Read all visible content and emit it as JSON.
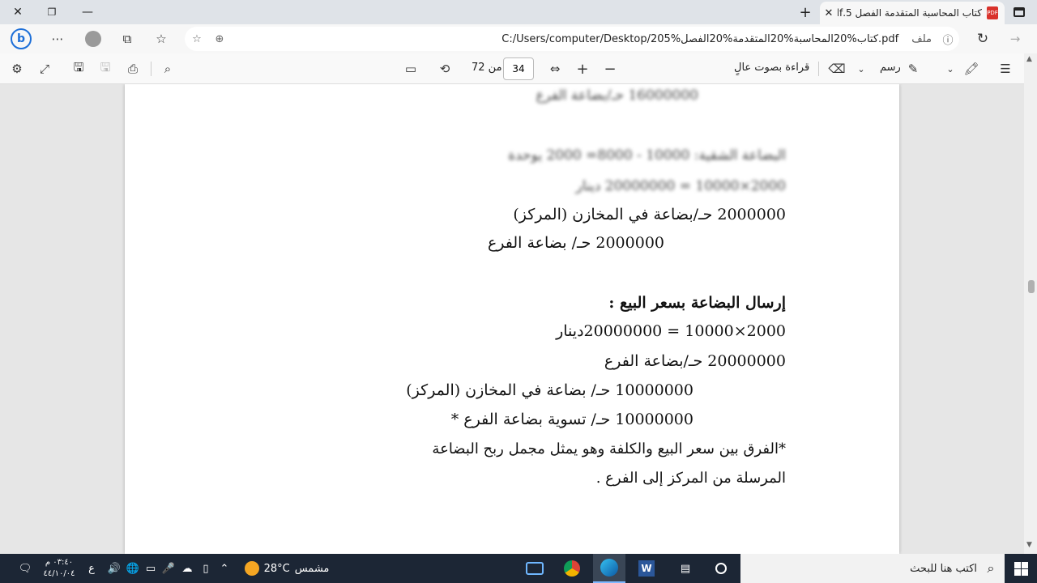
{
  "browser": {
    "tab_title": "كتاب المحاسبة المتقدمة الفصل 5.pdf",
    "url_label": "ملف",
    "url": "C:/Users/computer/Desktop/كتاب%20المحاسبة%20المتقدمة%20الفصل%205.pdf",
    "icons": [
      "close-icon",
      "restore-icon",
      "minimize-icon",
      "new-tab-icon",
      "bing-icon",
      "more-icon",
      "profile-icon",
      "collections-icon",
      "favorites-icon",
      "add-favorite-icon",
      "zoom-icon",
      "info-icon",
      "refresh-icon",
      "forward-icon",
      "tab-actions-icon"
    ]
  },
  "pdf_toolbar": {
    "page_current": "34",
    "page_total_label": "من 72",
    "read_aloud_label": "قراءة بصوت عالٍ",
    "draw_label": "رسم"
  },
  "document": {
    "blurred_lines": [
      "16000000 حـ/بضاعة الفرع",
      "البضاعة الشقية: 10000 - 8000= 2000 يوحدة",
      "2000×10000 = 20000000 دينار"
    ],
    "lines": [
      "2000000  حـ/بضاعة في المخازن (المركز)",
      "2000000 حـ/ بضاعة الفرع",
      "إرسال البضاعة بسعر البيع :",
      "2000×10000 = 20000000دينار",
      "20000000 حـ/بضاعة الفرع",
      "10000000 حـ/ بضاعة في المخازن (المركز)",
      "10000000 حـ/ تسوية بضاعة الفرع *",
      "*الفرق بين سعر البيع والكلفة وهو يمثل مجمل ربح البضاعة",
      "المرسلة من المركز إلى الفرع ."
    ]
  },
  "taskbar": {
    "search_placeholder": "اكتب هنا للبحث",
    "weather_temp": "28°C",
    "weather_label": "مشمس",
    "keyboard_lang": "ع",
    "time": "٠٣:٤٠ م",
    "date": "٤٤/١٠/٠٤",
    "colors": {
      "taskbar": "#1c2635",
      "accent": "#0078d4"
    }
  }
}
